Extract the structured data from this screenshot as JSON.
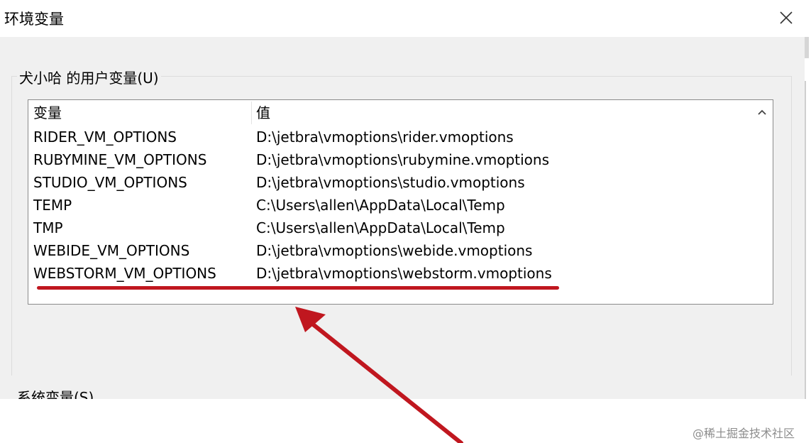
{
  "window": {
    "title": "环境变量",
    "close_icon": "close-icon"
  },
  "user_vars": {
    "group_label": "犬小哈 的用户变量(U)",
    "headers": {
      "name": "变量",
      "value": "值"
    },
    "rows": [
      {
        "name": "RIDER_VM_OPTIONS",
        "value": "D:\\jetbra\\vmoptions\\rider.vmoptions"
      },
      {
        "name": "RUBYMINE_VM_OPTIONS",
        "value": "D:\\jetbra\\vmoptions\\rubymine.vmoptions"
      },
      {
        "name": "STUDIO_VM_OPTIONS",
        "value": "D:\\jetbra\\vmoptions\\studio.vmoptions"
      },
      {
        "name": "TEMP",
        "value": "C:\\Users\\allen\\AppData\\Local\\Temp"
      },
      {
        "name": "TMP",
        "value": "C:\\Users\\allen\\AppData\\Local\\Temp"
      },
      {
        "name": "WEBIDE_VM_OPTIONS",
        "value": "D:\\jetbra\\vmoptions\\webide.vmoptions"
      },
      {
        "name": "WEBSTORM_VM_OPTIONS",
        "value": "D:\\jetbra\\vmoptions\\webstorm.vmoptions"
      }
    ],
    "scroll_icon": "chevron-up-icon"
  },
  "system_vars": {
    "group_label": "系统变量(S)"
  },
  "annotation": {
    "color": "#c0171f",
    "highlighted_row": "WEBSTORM_VM_OPTIONS"
  },
  "watermark": "@稀土掘金技术社区"
}
